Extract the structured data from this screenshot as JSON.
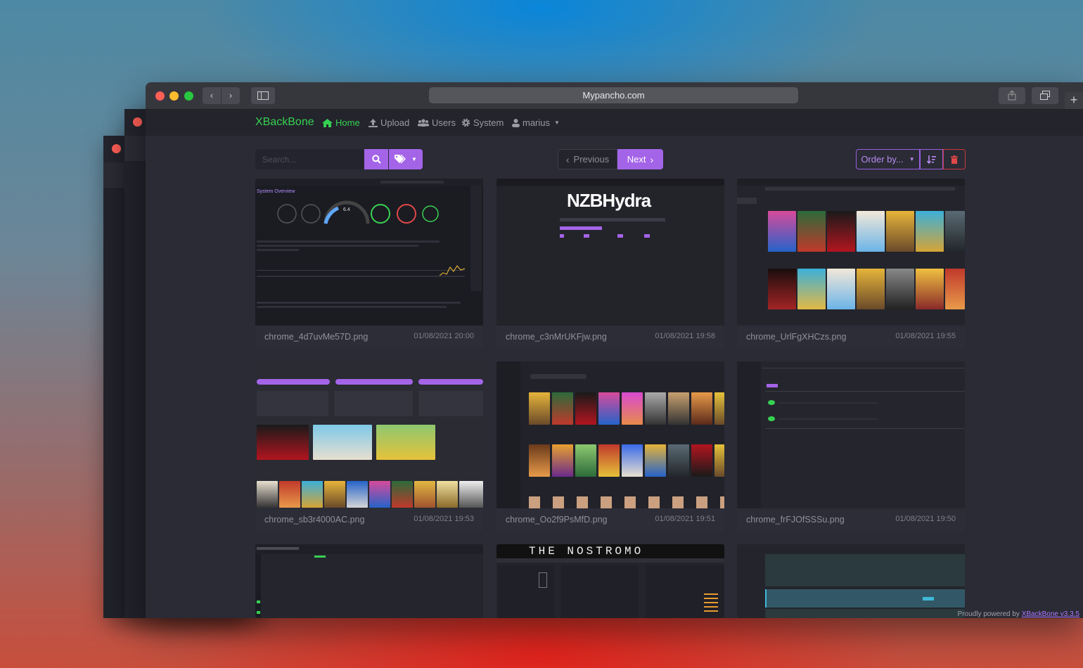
{
  "browser": {
    "url": "Mypancho.com",
    "nav_back": "‹",
    "nav_forward": "›"
  },
  "navbar": {
    "brand": "XBackBone",
    "items": [
      {
        "label": "Home",
        "icon": "home-icon",
        "active": true
      },
      {
        "label": "Upload",
        "icon": "upload-icon"
      },
      {
        "label": "Users",
        "icon": "users-icon"
      },
      {
        "label": "System",
        "icon": "gear-icon"
      },
      {
        "label": "marius",
        "icon": "user-icon",
        "dropdown": true
      }
    ]
  },
  "toolbar": {
    "search_placeholder": "Search...",
    "prev_label": "Previous",
    "next_label": "Next",
    "order_label": "Order by..."
  },
  "uploads": [
    {
      "filename": "chrome_4d7uvMe57D.png",
      "date": "01/08/2021 20:00",
      "thumb_title": "System Overview",
      "thumb_gauge": "6.4"
    },
    {
      "filename": "chrome_c3nMrUKFjw.png",
      "date": "01/08/2021 19:58",
      "thumb_title": "NZBHydra"
    },
    {
      "filename": "chrome_UrlFgXHCzs.png",
      "date": "01/08/2021 19:55"
    },
    {
      "filename": "chrome_sb3r4000AC.png",
      "date": "01/08/2021 19:53"
    },
    {
      "filename": "chrome_Oo2f9PsMfD.png",
      "date": "01/08/2021 19:51"
    },
    {
      "filename": "chrome_frFJOfSSSu.png",
      "date": "01/08/2021 19:50"
    },
    {
      "filename": "",
      "date": ""
    },
    {
      "filename": "",
      "date": "",
      "thumb_title": "THE NOSTROMO"
    },
    {
      "filename": "",
      "date": ""
    }
  ],
  "footer": {
    "credit_text": "Proudly powered by ",
    "credit_link": "XBackBone v3.3.5"
  },
  "colors": {
    "accent_green": "#37d152",
    "accent_purple": "#a464e8",
    "danger": "#e04848",
    "panel": "#2a2b35"
  }
}
